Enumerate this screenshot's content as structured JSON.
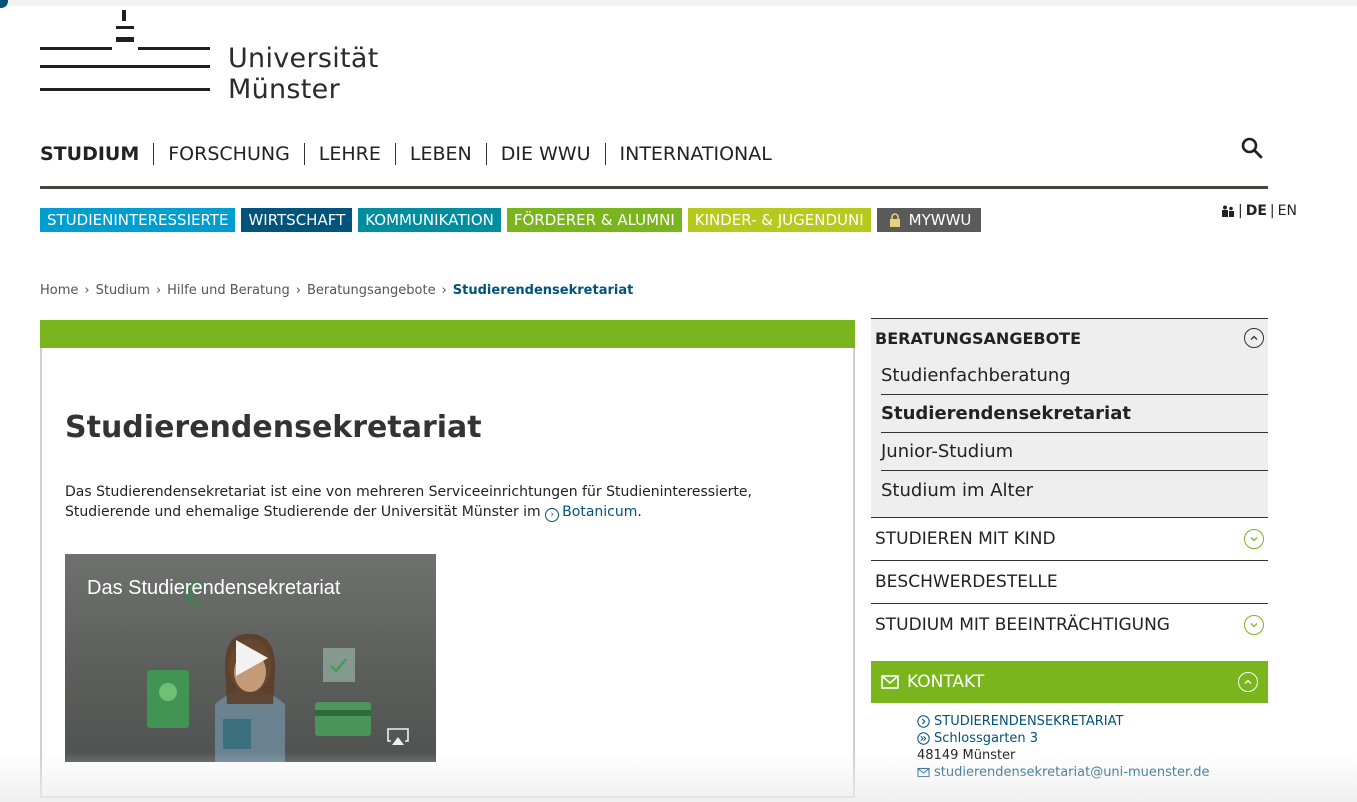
{
  "logo": {
    "line1": "Universität",
    "line2": "Münster"
  },
  "mainnav": {
    "items": [
      "STUDIUM",
      "FORSCHUNG",
      "LEHRE",
      "LEBEN",
      "DIE WWU",
      "INTERNATIONAL"
    ]
  },
  "subnav": {
    "tabs": [
      {
        "label": "STUDIENINTERESSIERTE",
        "color": "#009dd1"
      },
      {
        "label": "WIRTSCHAFT",
        "color": "#00537a"
      },
      {
        "label": "KOMMUNIKATION",
        "color": "#008d9e"
      },
      {
        "label": "FÖRDERER & ALUMNI",
        "color": "#7ab51d"
      },
      {
        "label": "KINDER- & JUGENDUNI",
        "color": "#b6c91d"
      },
      {
        "label": "MYWWU",
        "color": "#5a5a5a"
      }
    ]
  },
  "lang": {
    "de": "DE",
    "en": "EN",
    "sep": "|"
  },
  "breadcrumb": {
    "items": [
      "Home",
      "Studium",
      "Hilfe und Beratung",
      "Beratungsangebote"
    ],
    "current": "Studierendensekretariat",
    "sep": "›"
  },
  "main": {
    "title": "Studierendensekretariat",
    "intro_text": "Das Studierendensekretariat ist eine von mehreren Serviceeinrichtungen für Studieninteressierte, Studierende und ehemalige Studierende der Universität Münster im",
    "intro_link": "Botanicum",
    "intro_end": ".",
    "video_title": "Das Studierendensekretariat"
  },
  "sidebar": {
    "section_title": "BERATUNGSANGEBOTE",
    "sub_items": [
      "Studienfachberatung",
      "Studierendensekretariat",
      "Junior-Studium",
      "Studium im Alter"
    ],
    "rows": [
      "STUDIEREN MIT KIND",
      "BESCHWERDESTELLE",
      "STUDIUM MIT BEEINTRÄCHTIGUNG"
    ],
    "kontakt_label": "KONTAKT",
    "contact": {
      "name": "STUDIERENDENSEKRETARIAT",
      "street": "Schlossgarten 3",
      "city": "48149 Münster",
      "email": "studierendensekretariat@uni-muenster.de"
    }
  },
  "colors": {
    "accent_green": "#7ab51d",
    "link_blue": "#00537a"
  }
}
